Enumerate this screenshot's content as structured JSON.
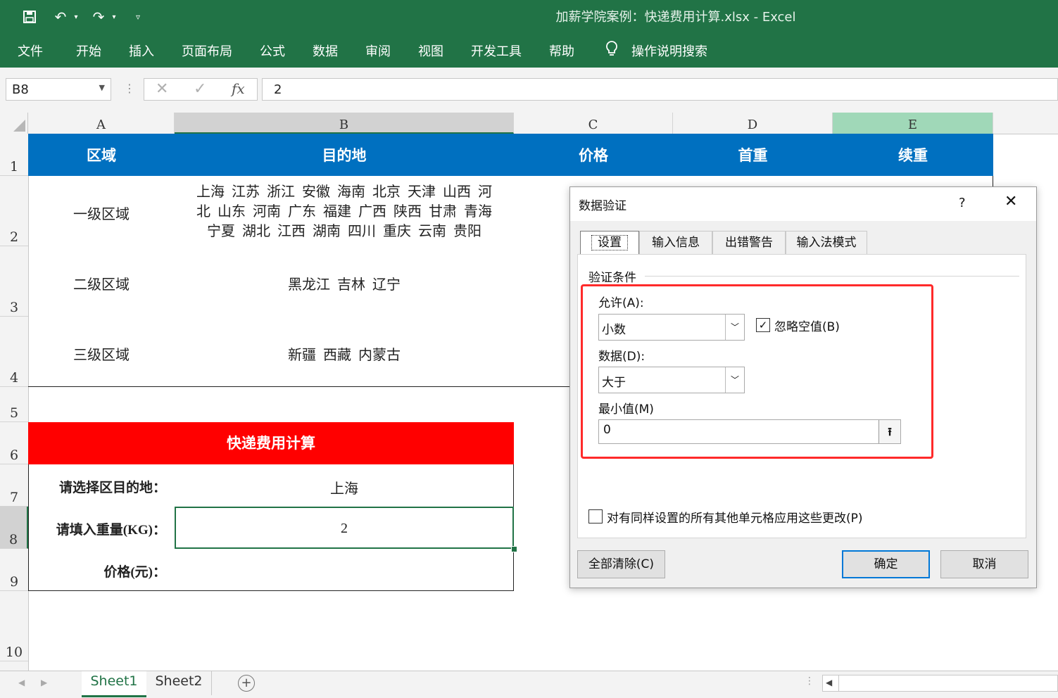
{
  "app": {
    "title": "加薪学院案例：快递费用计算.xlsx  -  Excel",
    "accent": "#217346"
  },
  "ribbon": {
    "tabs": [
      "文件",
      "开始",
      "插入",
      "页面布局",
      "公式",
      "数据",
      "审阅",
      "视图",
      "开发工具",
      "帮助",
      "操作说明搜索"
    ]
  },
  "formula_bar": {
    "name_box": "B8",
    "fx_label": "fx",
    "value": "2"
  },
  "grid": {
    "columns": [
      "A",
      "B",
      "C",
      "D",
      "E"
    ],
    "rows": [
      "1",
      "2",
      "3",
      "4",
      "5",
      "6",
      "7",
      "8",
      "9",
      "10"
    ],
    "header": {
      "a": "区域",
      "b": "目的地",
      "c": "价格",
      "d": "首重",
      "e": "续重",
      "color": "#0070c0"
    },
    "regions": [
      {
        "name": "一级区域",
        "dest_lines": [
          "上海  江苏  浙江  安徽  海南  北京  天津  山西  河",
          "北  山东  河南  广东  福建  广西  陕西  甘肃  青海",
          "宁夏  湖北  江西  湖南  四川  重庆  云南  贵阳"
        ]
      },
      {
        "name": "二级区域",
        "dest_lines": [
          "黑龙江  吉林  辽宁"
        ]
      },
      {
        "name": "三级区域",
        "dest_lines": [
          "新疆  西藏  内蒙古"
        ]
      }
    ],
    "calc": {
      "title": "快递费用计算",
      "title_color": "#ff0000",
      "dest_label": "请选择区目的地：",
      "dest_value": "上海",
      "weight_label": "请填入重量(KG)：",
      "weight_value": "2",
      "price_label": "价格(元)："
    }
  },
  "dialog": {
    "title": "数据验证",
    "help": "?",
    "tabs": [
      "设置",
      "输入信息",
      "出错警告",
      "输入法模式"
    ],
    "section": "验证条件",
    "allow_label": "允许(A):",
    "allow_value": "小数",
    "ignore_blank_label": "忽略空值(B)",
    "ignore_blank_checked": true,
    "data_label": "数据(D):",
    "data_value": "大于",
    "min_label": "最小值(M)",
    "min_value": "0",
    "apply_all_label": "对有同样设置的所有其他单元格应用这些更改(P)",
    "apply_all_checked": false,
    "clear_all": "全部清除(C)",
    "ok": "确定",
    "cancel": "取消",
    "highlight_color": "#ff0000"
  },
  "sheets": {
    "tabs": [
      "Sheet1",
      "Sheet2"
    ],
    "active": "Sheet1"
  }
}
